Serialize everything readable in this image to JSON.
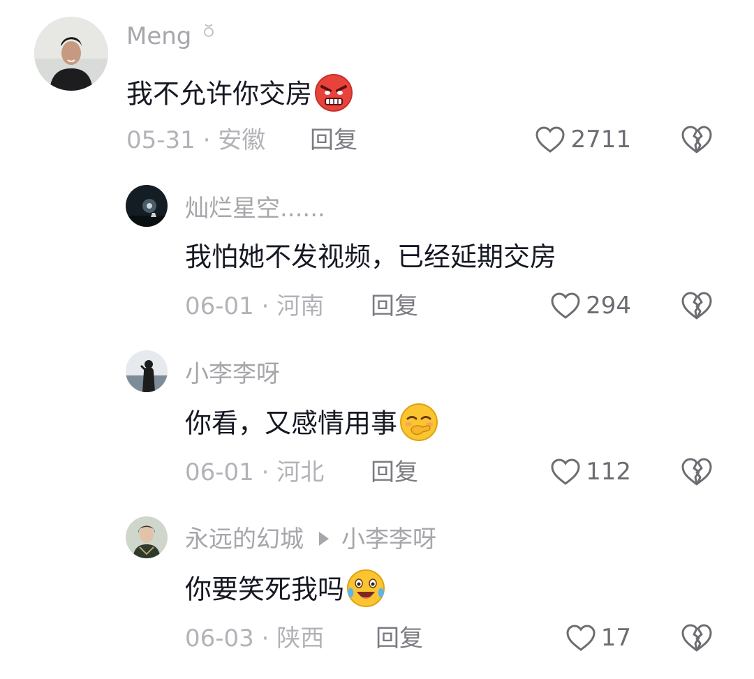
{
  "comments": [
    {
      "username": "Meng",
      "text": "我不允许你交房",
      "emoji": "angry-face-icon",
      "date": "05-31",
      "location": "安徽",
      "reply_label": "回复",
      "likes": "2711"
    },
    {
      "username": "灿烂星空......",
      "text": "我怕她不发视频，已经延期交房",
      "date": "06-01",
      "location": "河南",
      "reply_label": "回复",
      "likes": "294"
    },
    {
      "username": "小李李呀",
      "text": "你看，又感情用事",
      "emoji": "smirk-hand-face-icon",
      "date": "06-01",
      "location": "河北",
      "reply_label": "回复",
      "likes": "112"
    },
    {
      "username": "永远的幻城",
      "reply_to": "小李李呀",
      "text": "你要笑死我吗",
      "emoji": "tears-of-joy-face-icon",
      "date": "06-03",
      "location": "陕西",
      "reply_label": "回复",
      "likes": "17"
    }
  ],
  "meta_separator": "·",
  "colors": {
    "username": "#a6a6ab",
    "text": "#161823",
    "meta": "#b2b3b8",
    "icon": "#6c6d72"
  }
}
